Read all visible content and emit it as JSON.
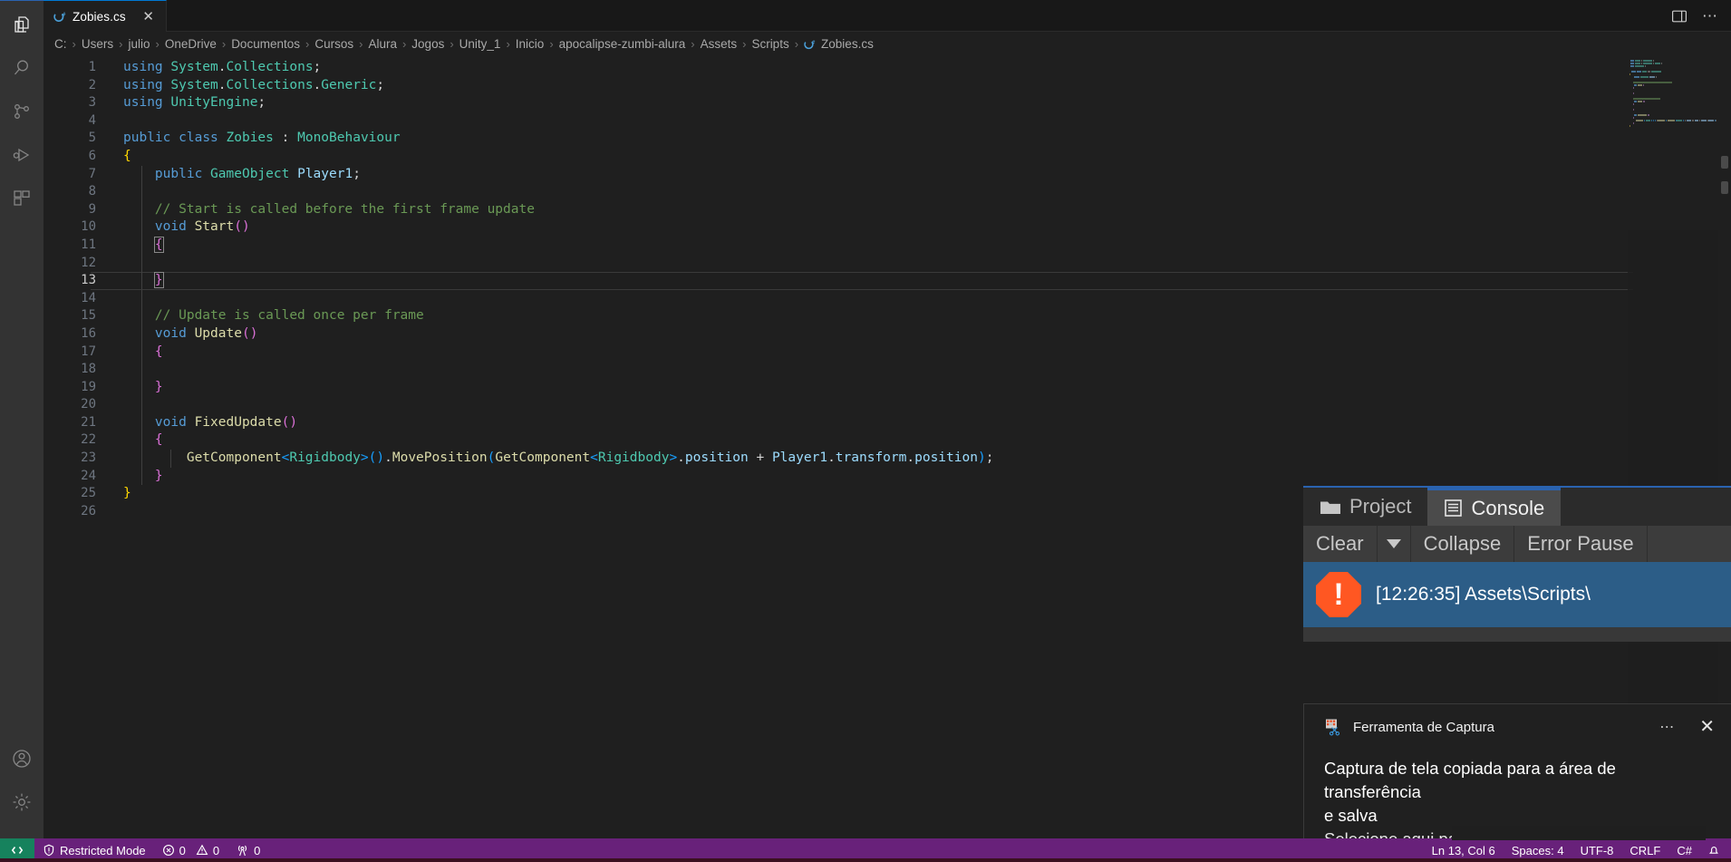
{
  "activity_bar": {
    "items": [
      {
        "name": "explorer",
        "icon": "files-icon",
        "active": true
      },
      {
        "name": "search",
        "icon": "search-icon",
        "active": false
      },
      {
        "name": "source-control",
        "icon": "source-control-icon",
        "active": false
      },
      {
        "name": "run-and-debug",
        "icon": "run-debug-icon",
        "active": false
      },
      {
        "name": "extensions",
        "icon": "extensions-icon",
        "active": false
      }
    ],
    "bottom_items": [
      {
        "name": "accounts",
        "icon": "account-icon"
      },
      {
        "name": "manage",
        "icon": "gear-icon"
      }
    ]
  },
  "tab": {
    "label": "Zobies.cs",
    "icon": "csharp-icon",
    "close": "✕"
  },
  "titlebar": {
    "layout_label": "toggle-panel",
    "more_label": "⋯"
  },
  "breadcrumbs": {
    "separator": "›",
    "items": [
      "C:",
      "Users",
      "julio",
      "OneDrive",
      "Documentos",
      "Cursos",
      "Alura",
      "Jogos",
      "Unity_1",
      "Inicio",
      "apocalipse-zumbi-alura",
      "Assets",
      "Scripts"
    ],
    "file": "Zobies.cs"
  },
  "editor": {
    "current_line": 13,
    "lines": [
      {
        "n": 1,
        "tokens": [
          {
            "t": "using",
            "c": "kw"
          },
          {
            "t": " ",
            "c": "plain"
          },
          {
            "t": "System",
            "c": "type"
          },
          {
            "t": ".",
            "c": "plain"
          },
          {
            "t": "Collections",
            "c": "type"
          },
          {
            "t": ";",
            "c": "plain"
          }
        ]
      },
      {
        "n": 2,
        "tokens": [
          {
            "t": "using",
            "c": "kw"
          },
          {
            "t": " ",
            "c": "plain"
          },
          {
            "t": "System",
            "c": "type"
          },
          {
            "t": ".",
            "c": "plain"
          },
          {
            "t": "Collections",
            "c": "type"
          },
          {
            "t": ".",
            "c": "plain"
          },
          {
            "t": "Generic",
            "c": "type"
          },
          {
            "t": ";",
            "c": "plain"
          }
        ]
      },
      {
        "n": 3,
        "tokens": [
          {
            "t": "using",
            "c": "kw"
          },
          {
            "t": " ",
            "c": "plain"
          },
          {
            "t": "UnityEngine",
            "c": "type"
          },
          {
            "t": ";",
            "c": "plain"
          }
        ]
      },
      {
        "n": 4,
        "tokens": []
      },
      {
        "n": 5,
        "tokens": [
          {
            "t": "public",
            "c": "kw"
          },
          {
            "t": " ",
            "c": "plain"
          },
          {
            "t": "class",
            "c": "kw"
          },
          {
            "t": " ",
            "c": "plain"
          },
          {
            "t": "Zobies",
            "c": "type"
          },
          {
            "t": " : ",
            "c": "plain"
          },
          {
            "t": "MonoBehaviour",
            "c": "type"
          }
        ]
      },
      {
        "n": 6,
        "tokens": [
          {
            "t": "{",
            "c": "br1"
          }
        ]
      },
      {
        "n": 7,
        "tokens": [
          {
            "t": "    ",
            "c": "plain"
          },
          {
            "t": "public",
            "c": "kw"
          },
          {
            "t": " ",
            "c": "plain"
          },
          {
            "t": "GameObject",
            "c": "type"
          },
          {
            "t": " ",
            "c": "plain"
          },
          {
            "t": "Player1",
            "c": "var"
          },
          {
            "t": ";",
            "c": "plain"
          }
        ]
      },
      {
        "n": 8,
        "tokens": []
      },
      {
        "n": 9,
        "tokens": [
          {
            "t": "    ",
            "c": "plain"
          },
          {
            "t": "// Start is called before the first frame update",
            "c": "cmt"
          }
        ]
      },
      {
        "n": 10,
        "tokens": [
          {
            "t": "    ",
            "c": "plain"
          },
          {
            "t": "void",
            "c": "kw"
          },
          {
            "t": " ",
            "c": "plain"
          },
          {
            "t": "Start",
            "c": "fn"
          },
          {
            "t": "()",
            "c": "br2"
          }
        ]
      },
      {
        "n": 11,
        "tokens": [
          {
            "t": "    ",
            "c": "plain"
          },
          {
            "t": "{",
            "c": "br2 brmatch"
          }
        ]
      },
      {
        "n": 12,
        "tokens": []
      },
      {
        "n": 13,
        "tokens": [
          {
            "t": "    ",
            "c": "plain"
          },
          {
            "t": "}",
            "c": "br2 brmatch"
          }
        ]
      },
      {
        "n": 14,
        "tokens": []
      },
      {
        "n": 15,
        "tokens": [
          {
            "t": "    ",
            "c": "plain"
          },
          {
            "t": "// Update is called once per frame",
            "c": "cmt"
          }
        ]
      },
      {
        "n": 16,
        "tokens": [
          {
            "t": "    ",
            "c": "plain"
          },
          {
            "t": "void",
            "c": "kw"
          },
          {
            "t": " ",
            "c": "plain"
          },
          {
            "t": "Update",
            "c": "fn"
          },
          {
            "t": "()",
            "c": "br2"
          }
        ]
      },
      {
        "n": 17,
        "tokens": [
          {
            "t": "    ",
            "c": "plain"
          },
          {
            "t": "{",
            "c": "br2"
          }
        ]
      },
      {
        "n": 18,
        "tokens": []
      },
      {
        "n": 19,
        "tokens": [
          {
            "t": "    ",
            "c": "plain"
          },
          {
            "t": "}",
            "c": "br2"
          }
        ]
      },
      {
        "n": 20,
        "tokens": []
      },
      {
        "n": 21,
        "tokens": [
          {
            "t": "    ",
            "c": "plain"
          },
          {
            "t": "void",
            "c": "kw"
          },
          {
            "t": " ",
            "c": "plain"
          },
          {
            "t": "FixedUpdate",
            "c": "fn"
          },
          {
            "t": "()",
            "c": "br2"
          }
        ]
      },
      {
        "n": 22,
        "tokens": [
          {
            "t": "    ",
            "c": "plain"
          },
          {
            "t": "{",
            "c": "br2"
          }
        ]
      },
      {
        "n": 23,
        "tokens": [
          {
            "t": "        ",
            "c": "plain"
          },
          {
            "t": "GetComponent",
            "c": "fn"
          },
          {
            "t": "<",
            "c": "br3"
          },
          {
            "t": "Rigidbody",
            "c": "type"
          },
          {
            "t": ">",
            "c": "br3"
          },
          {
            "t": "(",
            "c": "br3"
          },
          {
            "t": ")",
            "c": "br3"
          },
          {
            "t": ".",
            "c": "plain"
          },
          {
            "t": "MovePosition",
            "c": "fn"
          },
          {
            "t": "(",
            "c": "br3"
          },
          {
            "t": "GetComponent",
            "c": "fn"
          },
          {
            "t": "<",
            "c": "br3"
          },
          {
            "t": "Rigidbody",
            "c": "type"
          },
          {
            "t": ">",
            "c": "br3"
          },
          {
            "t": ".",
            "c": "plain"
          },
          {
            "t": "position",
            "c": "var"
          },
          {
            "t": " + ",
            "c": "plain"
          },
          {
            "t": "Player1",
            "c": "var"
          },
          {
            "t": ".",
            "c": "plain"
          },
          {
            "t": "transform",
            "c": "var"
          },
          {
            "t": ".",
            "c": "plain"
          },
          {
            "t": "position",
            "c": "var"
          },
          {
            "t": ")",
            "c": "br3"
          },
          {
            "t": ";",
            "c": "plain"
          }
        ]
      },
      {
        "n": 24,
        "tokens": [
          {
            "t": "    ",
            "c": "plain"
          },
          {
            "t": "}",
            "c": "br2"
          }
        ]
      },
      {
        "n": 25,
        "tokens": [
          {
            "t": "}",
            "c": "br1"
          }
        ]
      },
      {
        "n": 26,
        "tokens": []
      }
    ]
  },
  "unity_console": {
    "tabs": [
      {
        "label": "Project",
        "icon": "folder-icon",
        "active": false
      },
      {
        "label": "Console",
        "icon": "console-icon",
        "active": true
      }
    ],
    "toolbar": {
      "clear": "Clear",
      "clear_dropdown": "chevron-down-icon",
      "collapse": "Collapse",
      "error_pause": "Error Pause"
    },
    "entries": [
      {
        "severity": "error",
        "text": "[12:26:35] Assets\\Scripts\\"
      }
    ]
  },
  "toast": {
    "app_name": "Ferramenta de Captura",
    "app_icon": "snip-tool-icon",
    "more": "⋯",
    "close": "✕",
    "body_line1": "Captura de tela copiada para a área de transferência",
    "body_line2": "e salva",
    "subtext": "Selecione aqui para marcar e compartilhar."
  },
  "statusbar": {
    "remote_icon": "remote-indicator-icon",
    "restricted_mode": "Restricted Mode",
    "restricted_icon": "shield-icon",
    "errors": "0",
    "warnings": "0",
    "ports": "0",
    "cursor_position": "Ln 13, Col 6",
    "indentation": "Spaces: 4",
    "encoding": "UTF-8",
    "eol": "CRLF",
    "language": "C#",
    "notifications_icon": "bell-icon"
  },
  "colors": {
    "statusbar_bg": "#68217a",
    "remote_bg": "#16825d",
    "accent_blue": "#0078d4",
    "console_selected": "#2c5d87",
    "error_orange": "#ff5722",
    "editor_bg": "#1f1f1f",
    "activitybar_bg": "#333333"
  }
}
